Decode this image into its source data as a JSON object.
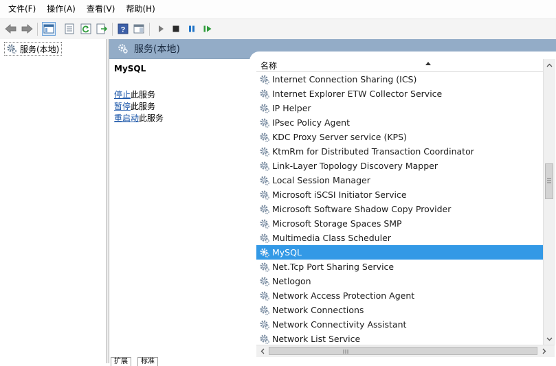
{
  "menubar": {
    "items": [
      "文件(F)",
      "操作(A)",
      "查看(V)",
      "帮助(H)"
    ]
  },
  "toolbar": {
    "buttons": [
      "back-icon",
      "forward-icon",
      "show-hide-tree-icon",
      "properties-icon",
      "refresh-icon",
      "export-list-icon",
      "help-icon",
      "show-hide-action-pane-icon",
      "start-service-icon",
      "stop-service-icon",
      "pause-service-icon",
      "restart-service-icon"
    ]
  },
  "tree": {
    "root_label": "服务(本地)"
  },
  "header": {
    "title": "服务(本地)"
  },
  "description": {
    "service_name": "MySQL",
    "actions": [
      {
        "link": "停止",
        "suffix": "此服务"
      },
      {
        "link": "暂停",
        "suffix": "此服务"
      },
      {
        "link": "重启动",
        "suffix": "此服务"
      }
    ]
  },
  "list": {
    "column_name": "名称",
    "selected": "MySQL",
    "rows": [
      "Internet Connection Sharing (ICS)",
      "Internet Explorer ETW Collector Service",
      "IP Helper",
      "IPsec Policy Agent",
      "KDC Proxy Server service (KPS)",
      "KtmRm for Distributed Transaction Coordinator",
      "Link-Layer Topology Discovery Mapper",
      "Local Session Manager",
      "Microsoft iSCSI Initiator Service",
      "Microsoft Software Shadow Copy Provider",
      "Microsoft Storage Spaces SMP",
      "Multimedia Class Scheduler",
      "MySQL",
      "Net.Tcp Port Sharing Service",
      "Netlogon",
      "Network Access Protection Agent",
      "Network Connections",
      "Network Connectivity Assistant",
      "Network List Service"
    ]
  },
  "tabs": {
    "items": [
      "扩展",
      "标准"
    ]
  },
  "colors": {
    "selection": "#3399e6",
    "header_bg": "#93acc7",
    "link": "#1a55a8"
  }
}
